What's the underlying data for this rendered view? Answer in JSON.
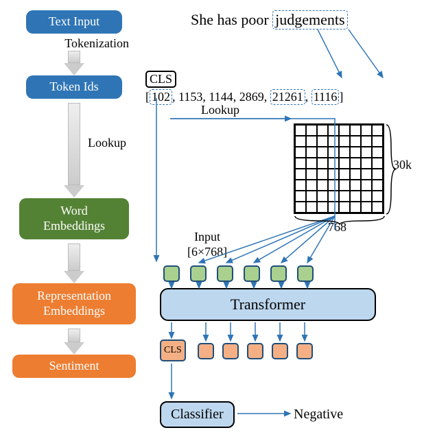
{
  "left_pipeline": {
    "text_input": "Text Input",
    "tokenization": "Tokenization",
    "token_ids": "Token Ids",
    "lookup": "Lookup",
    "word_embeddings": "Word\nEmbeddings",
    "rep_embeddings": "Representation\nEmbeddings",
    "sentiment": "Sentiment"
  },
  "sentence": {
    "pre": "She has poor ",
    "word": "judgements"
  },
  "cls": "CLS",
  "token_ids": {
    "t0": "102",
    "t1": "1153",
    "t2": "1144",
    "t3": "2869",
    "t4": "21261",
    "t5": "1116"
  },
  "lookup2": "Lookup",
  "grid": {
    "rows_label": "30k",
    "cols_label": "768"
  },
  "input_dims": {
    "l1": "Input",
    "l2": "[6×768]"
  },
  "transformer": "Transformer",
  "classifier": "Classifier",
  "negative": "Negative",
  "cls_small": "CLS"
}
